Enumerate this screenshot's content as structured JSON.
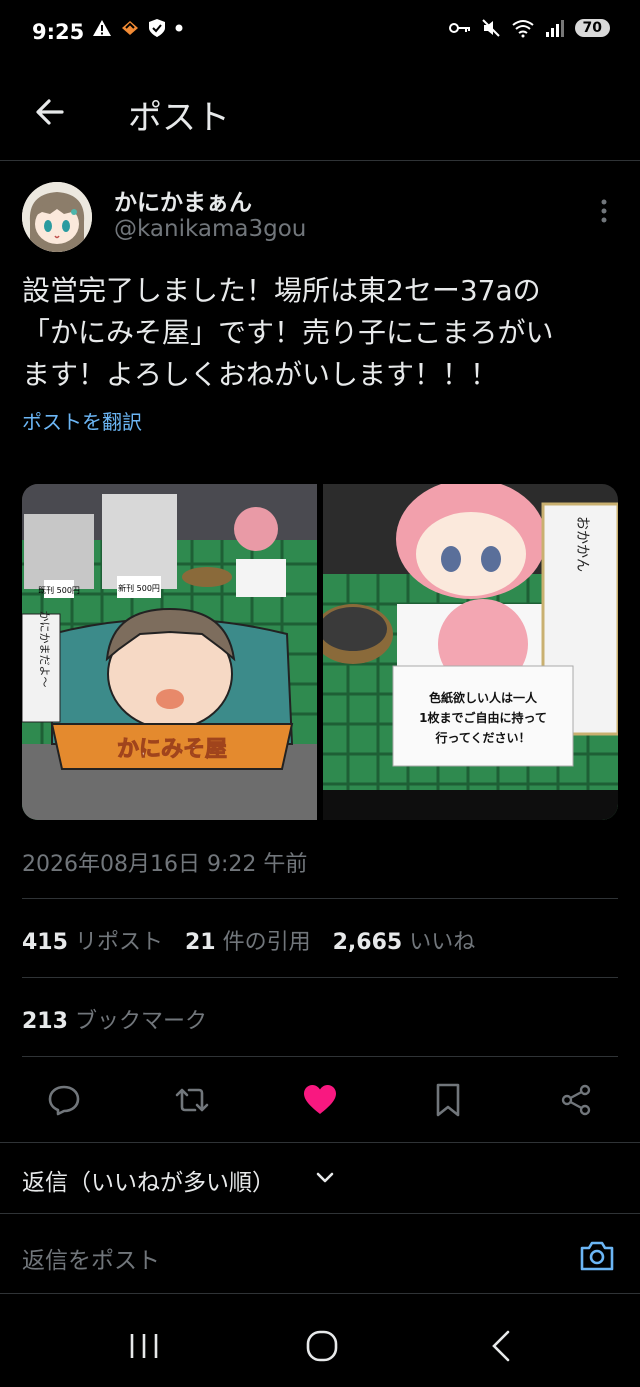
{
  "status_bar": {
    "time": "9:25",
    "battery": "70",
    "icons": [
      "warning-icon",
      "app-icon",
      "shield-icon",
      "dot-icon",
      "key-icon",
      "mute-icon",
      "wifi-icon",
      "signal-icon"
    ]
  },
  "header": {
    "title": "ポスト"
  },
  "post": {
    "display_name": "かにかまぁん",
    "handle": "@kanikama3gou",
    "text": "設営完了しました！場所は東2セー37aの\n「かにみそ屋」です！売り子にこまろがい\nます！よろしくおねがいします！！！",
    "translate": "ポストを翻訳",
    "timestamp": "2026年08月16日 9:22 午前",
    "images": [
      {
        "desc_text_1": "かにかまだよ〜",
        "desc_text_2": "かにみそ屋",
        "label_1": "既刊 500円",
        "label_2": "新刊 500円"
      },
      {
        "sign": "色紙欲しい人は一人\n1枚までご自由に持って\n行ってください！",
        "note": "おかかん"
      }
    ]
  },
  "stats": {
    "reposts_count": "415",
    "reposts_label": "リポスト",
    "quotes_count": "21",
    "quotes_label": "件の引用",
    "likes_count": "2,665",
    "likes_label": "いいね",
    "bookmarks_count": "213",
    "bookmarks_label": "ブックマーク"
  },
  "actions": [
    "reply-icon",
    "repost-icon",
    "like-icon",
    "bookmark-icon",
    "share-icon"
  ],
  "colors": {
    "like": "#f91880",
    "link": "#6cb6f5",
    "muted": "#71767b"
  },
  "replies": {
    "sort_label": "返信（いいねが多い順）",
    "input_placeholder": "返信をポスト"
  }
}
